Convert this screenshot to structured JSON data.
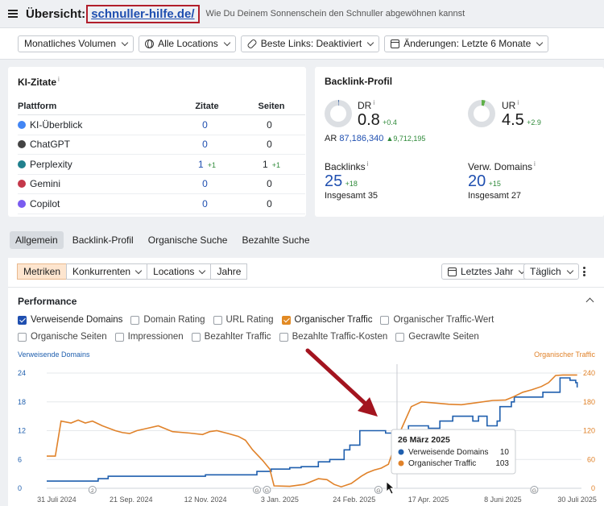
{
  "header": {
    "title": "Übersicht:",
    "domain": "schnuller-hilfe.de/",
    "subtitle": "Wie Du Deinem Sonnenschein den Schnuller abgewöhnen kannst"
  },
  "filters": {
    "volume": "Monatliches Volumen",
    "locations": "Alle Locations",
    "best_links": "Beste Links: Deaktiviert",
    "changes": "Änderungen: Letzte 6 Monate"
  },
  "ki": {
    "title": "KI-Zitate",
    "info": "i",
    "headers": {
      "platform": "Plattform",
      "citations": "Zitate",
      "pages": "Seiten"
    },
    "rows": [
      {
        "name": "KI-Überblick",
        "icon": "google-icon",
        "color": "#4285f4",
        "citations": "0",
        "citations_delta": "",
        "pages": "0",
        "pages_delta": ""
      },
      {
        "name": "ChatGPT",
        "icon": "chatgpt-icon",
        "color": "#444444",
        "citations": "0",
        "citations_delta": "",
        "pages": "0",
        "pages_delta": ""
      },
      {
        "name": "Perplexity",
        "icon": "perplexity-icon",
        "color": "#20808d",
        "citations": "1",
        "citations_delta": "+1",
        "pages": "1",
        "pages_delta": "+1"
      },
      {
        "name": "Gemini",
        "icon": "gemini-icon",
        "color": "#c4384a",
        "citations": "0",
        "citations_delta": "",
        "pages": "0",
        "pages_delta": ""
      },
      {
        "name": "Copilot",
        "icon": "copilot-icon",
        "color": "#7a5cf0",
        "citations": "0",
        "citations_delta": "",
        "pages": "0",
        "pages_delta": ""
      }
    ]
  },
  "backlink": {
    "title": "Backlink-Profil",
    "dr_label": "DR",
    "dr_value": "0.8",
    "dr_delta": "+0.4",
    "ar_label": "AR",
    "ar_value": "87,186,340",
    "ar_delta": "9,712,195",
    "ur_label": "UR",
    "ur_value": "4.5",
    "ur_delta": "+2.9",
    "backlinks_label": "Backlinks",
    "backlinks_value": "25",
    "backlinks_delta": "+18",
    "backlinks_total_label": "Insgesamt",
    "backlinks_total": "35",
    "domains_label": "Verw. Domains",
    "domains_value": "20",
    "domains_delta": "+15",
    "domains_total_label": "Insgesamt",
    "domains_total": "27",
    "info": "i",
    "dr_fill": 0.008,
    "ur_fill": 0.045
  },
  "tabs": [
    "Allgemein",
    "Backlink-Profil",
    "Organische Suche",
    "Bezahlte Suche"
  ],
  "chart_controls": {
    "segments": [
      "Metriken",
      "Konkurrenten",
      "Locations",
      "Jahre"
    ],
    "period": "Letztes Jahr",
    "granularity": "Täglich"
  },
  "performance": {
    "title": "Performance",
    "metrics": [
      {
        "label": "Verweisende Domains",
        "checked": true,
        "color": "blue"
      },
      {
        "label": "Domain Rating",
        "checked": false
      },
      {
        "label": "URL Rating",
        "checked": false
      },
      {
        "label": "Organischer Traffic",
        "checked": true,
        "color": "orange"
      },
      {
        "label": "Organischer Traffic-Wert",
        "checked": false
      },
      {
        "label": "Organische Seiten",
        "checked": false
      },
      {
        "label": "Impressionen",
        "checked": false
      },
      {
        "label": "Bezahlter Traffic",
        "checked": false
      },
      {
        "label": "Bezahlte Traffic-Kosten",
        "checked": false
      },
      {
        "label": "Gecrawlte Seiten",
        "checked": false
      }
    ]
  },
  "chart_data": {
    "type": "line",
    "left_axis_label": "Verweisende Domains",
    "right_axis_label": "Organischer Traffic",
    "left_ticks": [
      "0",
      "6",
      "12",
      "18",
      "24"
    ],
    "right_ticks": [
      "0",
      "60",
      "120",
      "180",
      "240"
    ],
    "left_range": [
      0,
      24
    ],
    "right_range": [
      0,
      240
    ],
    "x_range": [
      "2024-07-24",
      "2025-08-02"
    ],
    "x_ticks": [
      {
        "date": "2024-07-31",
        "label": "31 Juli 2024"
      },
      {
        "date": "2024-09-21",
        "label": "21 Sep. 2024"
      },
      {
        "date": "2024-11-12",
        "label": "12 Nov. 2024"
      },
      {
        "date": "2025-01-03",
        "label": "3 Jan. 2025"
      },
      {
        "date": "2025-02-24",
        "label": "24 Feb. 2025"
      },
      {
        "date": "2025-04-17",
        "label": "17 Apr. 2025"
      },
      {
        "date": "2025-06-08",
        "label": "8 Juni 2025"
      },
      {
        "date": "2025-07-30",
        "label": "30 Juli 2025"
      }
    ],
    "event_markers": [
      {
        "date": "2024-08-25",
        "label": "2"
      },
      {
        "date": "2024-12-18",
        "label": "G"
      },
      {
        "date": "2024-12-25",
        "label": "G"
      },
      {
        "date": "2025-03-13",
        "label": "G"
      },
      {
        "date": "2025-06-30",
        "label": "G"
      }
    ],
    "series": [
      {
        "name": "Verweisende Domains",
        "axis": "left",
        "color": "#1f5fae",
        "step": true,
        "points": [
          [
            "2024-07-24",
            1.5
          ],
          [
            "2024-08-29",
            2
          ],
          [
            "2024-09-05",
            2.5
          ],
          [
            "2024-11-12",
            2.8
          ],
          [
            "2024-12-18",
            3.5
          ],
          [
            "2024-12-28",
            4
          ],
          [
            "2025-01-10",
            4.3
          ],
          [
            "2025-01-18",
            4.5
          ],
          [
            "2025-01-30",
            5.5
          ],
          [
            "2025-02-07",
            6
          ],
          [
            "2025-02-17",
            8
          ],
          [
            "2025-02-21",
            9
          ],
          [
            "2025-02-28",
            12
          ],
          [
            "2025-03-18",
            11.5
          ],
          [
            "2025-03-26",
            10
          ],
          [
            "2025-04-03",
            13
          ],
          [
            "2025-04-17",
            12.5
          ],
          [
            "2025-04-25",
            14
          ],
          [
            "2025-05-04",
            15
          ],
          [
            "2025-05-18",
            14
          ],
          [
            "2025-05-22",
            15
          ],
          [
            "2025-05-28",
            13
          ],
          [
            "2025-06-04",
            14
          ],
          [
            "2025-06-06",
            17
          ],
          [
            "2025-06-14",
            18
          ],
          [
            "2025-06-16",
            19
          ],
          [
            "2025-07-06",
            20
          ],
          [
            "2025-07-18",
            23
          ],
          [
            "2025-07-25",
            22.5
          ],
          [
            "2025-07-29",
            22
          ],
          [
            "2025-07-30",
            21
          ]
        ]
      },
      {
        "name": "Organischer Traffic",
        "axis": "right",
        "color": "#e0822a",
        "step": false,
        "points": [
          [
            "2024-07-24",
            67
          ],
          [
            "2024-07-30",
            67
          ],
          [
            "2024-08-03",
            140
          ],
          [
            "2024-08-10",
            136
          ],
          [
            "2024-08-15",
            142
          ],
          [
            "2024-08-20",
            136
          ],
          [
            "2024-08-25",
            140
          ],
          [
            "2024-09-01",
            130
          ],
          [
            "2024-09-10",
            120
          ],
          [
            "2024-09-15",
            116
          ],
          [
            "2024-09-20",
            114
          ],
          [
            "2024-09-25",
            120
          ],
          [
            "2024-10-01",
            124
          ],
          [
            "2024-10-10",
            130
          ],
          [
            "2024-10-15",
            124
          ],
          [
            "2024-10-20",
            118
          ],
          [
            "2024-11-01",
            115
          ],
          [
            "2024-11-10",
            112
          ],
          [
            "2024-11-15",
            118
          ],
          [
            "2024-11-20",
            120
          ],
          [
            "2024-11-28",
            114
          ],
          [
            "2024-12-05",
            108
          ],
          [
            "2024-12-10",
            100
          ],
          [
            "2024-12-15",
            80
          ],
          [
            "2024-12-22",
            58
          ],
          [
            "2024-12-27",
            40
          ],
          [
            "2024-12-30",
            5
          ],
          [
            "2025-01-10",
            4
          ],
          [
            "2025-01-20",
            8
          ],
          [
            "2025-01-30",
            20
          ],
          [
            "2025-02-05",
            18
          ],
          [
            "2025-02-10",
            8
          ],
          [
            "2025-02-15",
            3
          ],
          [
            "2025-02-22",
            10
          ],
          [
            "2025-03-01",
            25
          ],
          [
            "2025-03-05",
            32
          ],
          [
            "2025-03-10",
            38
          ],
          [
            "2025-03-15",
            42
          ],
          [
            "2025-03-20",
            50
          ],
          [
            "2025-03-26",
            103
          ],
          [
            "2025-03-30",
            130
          ],
          [
            "2025-04-05",
            170
          ],
          [
            "2025-04-12",
            180
          ],
          [
            "2025-04-20",
            178
          ],
          [
            "2025-05-01",
            175
          ],
          [
            "2025-05-10",
            174
          ],
          [
            "2025-05-20",
            178
          ],
          [
            "2025-06-01",
            183
          ],
          [
            "2025-06-10",
            184
          ],
          [
            "2025-06-15",
            190
          ],
          [
            "2025-06-22",
            200
          ],
          [
            "2025-06-28",
            205
          ],
          [
            "2025-07-05",
            212
          ],
          [
            "2025-07-10",
            220
          ],
          [
            "2025-07-15",
            235
          ],
          [
            "2025-07-20",
            236
          ],
          [
            "2025-07-25",
            236
          ],
          [
            "2025-07-30",
            236
          ]
        ]
      }
    ],
    "tooltip": {
      "date": "26 März 2025",
      "x": "2025-03-26",
      "rows": [
        {
          "label": "Verweisende Domains",
          "value": "10",
          "color": "#1f5fae"
        },
        {
          "label": "Organischer Traffic",
          "value": "103",
          "color": "#e0822a"
        }
      ]
    }
  }
}
